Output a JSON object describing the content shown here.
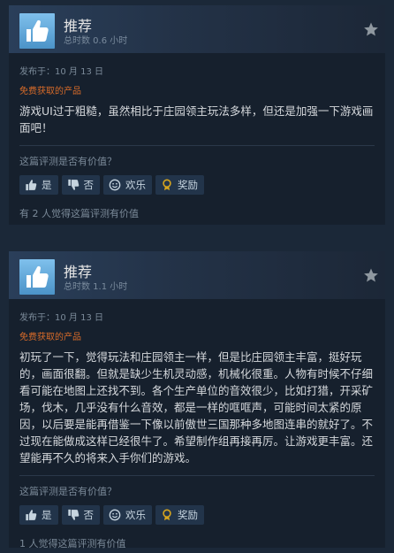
{
  "reviews": [
    {
      "recommendation": "推荐",
      "playtime": "总时数 0.6 小时",
      "posted": "发布于：10 月 13 日",
      "free_label": "免费获取的产品",
      "content": "游戏UI过于粗糙，虽然相比于庄园领主玩法多样，但还是加强一下游戏画面吧！",
      "helpful_question": "这篇评测是否有价值？",
      "buttons": {
        "yes": "是",
        "no": "否",
        "funny": "欢乐",
        "award": "奖励"
      },
      "helpful_count": "有 2 人觉得这篇评测有价值"
    },
    {
      "recommendation": "推荐",
      "playtime": "总时数 1.1 小时",
      "posted": "发布于：10 月 13 日",
      "free_label": "免费获取的产品",
      "content": "初玩了一下，觉得玩法和庄园领主一样，但是比庄园领主丰富，挺好玩的，画面很翻。但就是缺少生机灵动感，机械化很重。人物有时候不仔细看可能在地图上还找不到。各个生产单位的音效很少，比如打猎，开采矿场，伐木，几乎没有什么音效，都是一样的哐哐声，可能时间太紧的原因，以后要是能再借鉴一下像以前傲世三国那种多地图连串的就好了。不过现在能做成这样已经很牛了。希望制作组再接再厉。让游戏更丰富。还望能再不久的将来入手你们的游戏。",
      "helpful_question": "这篇评测是否有价值？",
      "buttons": {
        "yes": "是",
        "no": "否",
        "funny": "欢乐",
        "award": "奖励"
      },
      "helpful_count": "1 人觉得这篇评测有价值"
    }
  ],
  "icons": {
    "recommend": "thumbs-up-icon",
    "bookmark": "star-icon",
    "yes": "thumbs-up-icon",
    "no": "thumbs-down-icon",
    "funny": "smiley-icon",
    "award": "award-icon"
  },
  "colors": {
    "background": "#1b2838",
    "card": "#16202d",
    "free_label": "#d86b29",
    "thumb_tile": "#67b0e0",
    "award_icon": "#d7a51e"
  }
}
